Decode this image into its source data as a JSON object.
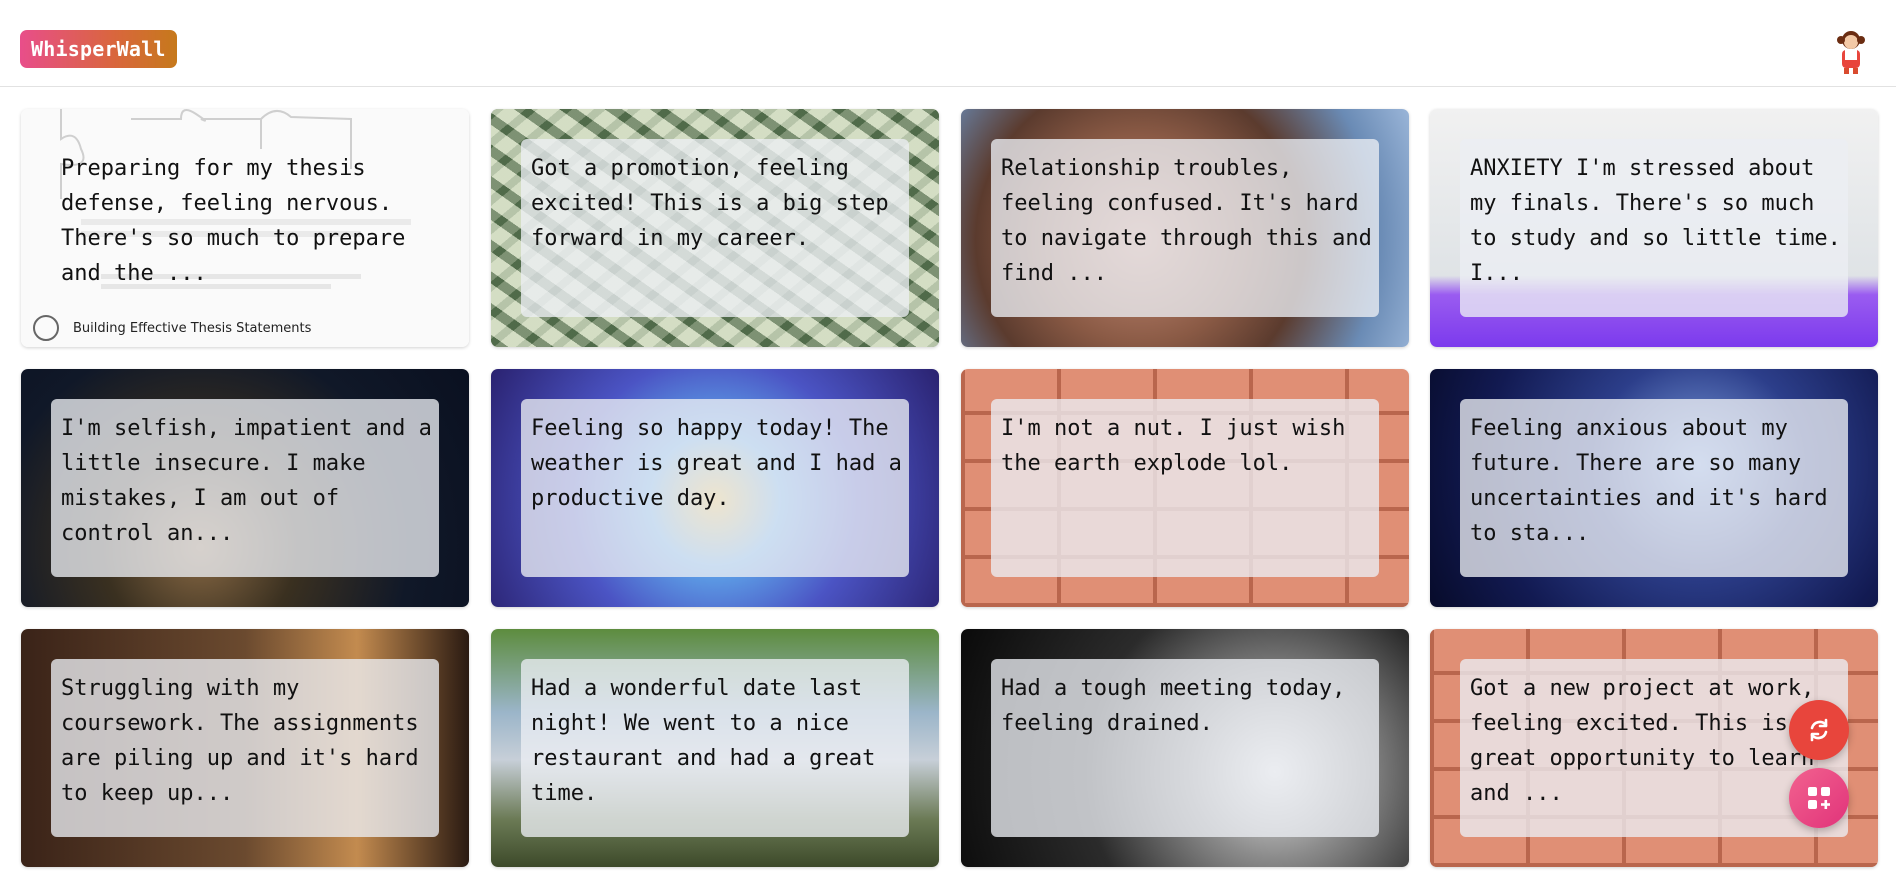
{
  "app": {
    "brand": "WhisperWall"
  },
  "cards": [
    {
      "text": "Preparing for my thesis defense, feeling nervous. There's so much to prepare and the ...",
      "image_caption": "Building Effective Thesis Statements"
    },
    {
      "text": "Got a promotion, feeling excited! This is a big step forward in my career."
    },
    {
      "text": "Relationship troubles, feeling confused. It's hard to navigate through this and find ..."
    },
    {
      "text": "ANXIETY I'm stressed about my finals. There's so much to study and so little time. I..."
    },
    {
      "text": "I'm selfish, impatient and a little insecure. I make mistakes, I am out of control an..."
    },
    {
      "text": "Feeling so happy today! The weather is great and I had a productive day."
    },
    {
      "text": "I'm not a nut. I just wish the earth explode lol."
    },
    {
      "text": "Feeling anxious about my future. There are so many uncertainties and it's hard to sta..."
    },
    {
      "text": "Struggling with my coursework. The assignments are piling up and it's hard to keep up..."
    },
    {
      "text": "Had a wonderful date last night! We went to a nice restaurant and had a great time."
    },
    {
      "text": "Had a tough meeting today, feeling drained."
    },
    {
      "text": "Got a new project at work, feeling excited. This is a great opportunity to learn and ..."
    }
  ],
  "colors": {
    "brand_gradient_start": "#e84e8a",
    "brand_gradient_end": "#c6791b",
    "refresh_button": "#e8453c",
    "add_button": "#e1337a"
  },
  "icons": {
    "avatar": "user-avatar-icon",
    "refresh": "refresh-icon",
    "add": "add-grid-icon"
  }
}
